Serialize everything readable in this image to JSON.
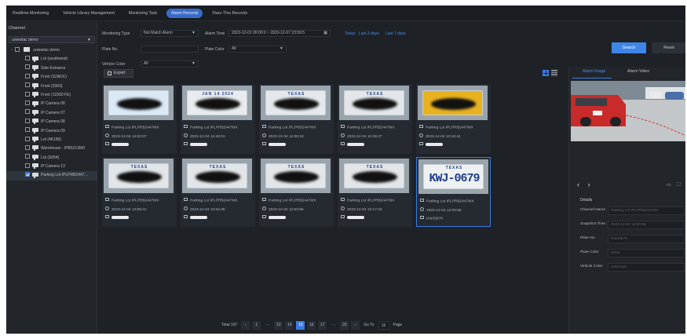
{
  "tabs": [
    {
      "label": "Realtime Monitoring",
      "active": false
    },
    {
      "label": "Vehicle Library Management",
      "active": false
    },
    {
      "label": "Monitoring Task",
      "active": false
    },
    {
      "label": "Alarm Records",
      "active": true
    },
    {
      "label": "Pass-Thru Records",
      "active": false
    }
  ],
  "sidebar": {
    "title": "Channel",
    "select_value": "uniewtac demo",
    "root_label": "uniewtac demo",
    "items": [
      {
        "label": "Lot (southwest)",
        "checked": false
      },
      {
        "label": "Side Entrance",
        "checked": false
      },
      {
        "label": "Front (S2ADC)",
        "checked": false
      },
      {
        "label": "Front (5360)",
        "checked": false
      },
      {
        "label": "Front (12360 FE)",
        "checked": false
      },
      {
        "label": "IP Camera 06",
        "checked": false
      },
      {
        "label": "IP Camera 07",
        "checked": false
      },
      {
        "label": "IP Camera 08",
        "checked": false
      },
      {
        "label": "IP Camera 09",
        "checked": false
      },
      {
        "label": "Lot (4K180)",
        "checked": false
      },
      {
        "label": "Warehouse - IPB5213MX",
        "checked": false
      },
      {
        "label": "Lot (S054)",
        "checked": false
      },
      {
        "label": "IP Camera 13",
        "checked": false
      },
      {
        "label": "Parking Lot IPLPRB2447...",
        "checked": true
      }
    ]
  },
  "filters": {
    "monitoring_type_label": "Monitoring Type",
    "monitoring_type_value": "Not Match Alarm",
    "alarm_time_label": "Alarm Time",
    "alarm_time_value": "2023-12-01 00:00:0  ~  2023-12-07 23:59:5",
    "quick_today": "Today",
    "quick_3days": "Last 3 days",
    "quick_7days": "Last 7 days",
    "plate_no_label": "Plate No.",
    "plate_no_value": "",
    "plate_color_label": "Plate Color",
    "plate_color_value": "All",
    "vehicle_color_label": "Vehicle Color",
    "vehicle_color_value": "All",
    "search_label": "Search",
    "reset_label": "Reset"
  },
  "toolbar": {
    "export_label": "Export"
  },
  "records": [
    {
      "channel": "Parking Lot IPLPRB2447MX",
      "time": "2023-12-04 14:53:37",
      "plate_state": "",
      "plate_num": "",
      "plate_bg": "#dbe9f7",
      "plate_text": "",
      "selected": false
    },
    {
      "channel": "Parking Lot IPLPRB2447MX",
      "time": "2023-12-04 14:48:01",
      "plate_state": "JAN 14 2024",
      "plate_num": "",
      "plate_bg": "#e9ecee",
      "plate_text": "",
      "selected": false
    },
    {
      "channel": "Parking Lot IPLPRB2447MX",
      "time": "2023-12-04 14:38:19",
      "plate_state": "TEXAS",
      "plate_num": "",
      "plate_bg": "#e6e9ec",
      "plate_text": "",
      "selected": false
    },
    {
      "channel": "Parking Lot IPLPRB2447MX",
      "time": "2023-12-04 13:45:27",
      "plate_state": "TEXAS",
      "plate_num": "",
      "plate_bg": "#e4e7ea",
      "plate_text": "",
      "selected": false
    },
    {
      "channel": "Parking Lot IPLPRB2447MX",
      "time": "2023-12-04 13:16:44",
      "plate_state": "",
      "plate_num": "",
      "plate_bg": "#e8b21f",
      "plate_text": "",
      "selected": false
    },
    {
      "channel": "Parking Lot IPLPRB2447MX",
      "time": "2023-12-04 12:55:41",
      "plate_state": "TEXAS",
      "plate_num": "",
      "plate_bg": "#e3e6e9",
      "plate_text": "",
      "selected": false
    },
    {
      "channel": "Parking Lot IPLPRB2447MX",
      "time": "2023-12-04 12:54:36",
      "plate_state": "TEXAS",
      "plate_num": "",
      "plate_bg": "#e3e6e9",
      "plate_text": "",
      "selected": false
    },
    {
      "channel": "Parking Lot IPLPRB2447MX",
      "time": "2023-12-04 12:50:56",
      "plate_state": "TEXAS",
      "plate_num": "",
      "plate_bg": "#e3e6e9",
      "plate_text": "",
      "selected": false
    },
    {
      "channel": "Parking Lot IPLPRB2447MX",
      "time": "2023-12-04 12:17:42",
      "plate_state": "TEXAS",
      "plate_num": "",
      "plate_bg": "#e3e6e9",
      "plate_text": "",
      "selected": false
    },
    {
      "channel": "Parking Lot IPLPRB2447MX",
      "time": "2023-12-04 12:00:56",
      "plate_state": "TEXAS",
      "plate_num": "KWJ-0679",
      "plate_bg": "#eef1f3",
      "plate_text": "KWJ0679",
      "selected": true
    }
  ],
  "pagination": {
    "total": "Total 197",
    "pages": [
      "1",
      "···",
      "13",
      "14",
      "15",
      "16",
      "17",
      "···",
      "20"
    ],
    "active_page": "15",
    "goto_label": "Go To",
    "goto_value": "15",
    "page_label": "Page",
    "prev": "‹",
    "next": "›"
  },
  "detail_panel": {
    "tab_image": "Alarm Image",
    "tab_video": "Alarm Video",
    "details_title": "Details",
    "fields": [
      {
        "label": "Channel Name",
        "value": "Parking Lot IPLPRB2447MX"
      },
      {
        "label": "Snapshot Time",
        "value": "2023-12-04 12:00:56"
      },
      {
        "label": "Plate No.",
        "value": "KWJ0679"
      },
      {
        "label": "Plate Color",
        "value": "Other"
      },
      {
        "label": "Vehicle Color",
        "value": "Unknown"
      }
    ]
  },
  "colors": {
    "accent": "#3b7be0",
    "background": "#1e2227",
    "panel": "#22262b"
  }
}
